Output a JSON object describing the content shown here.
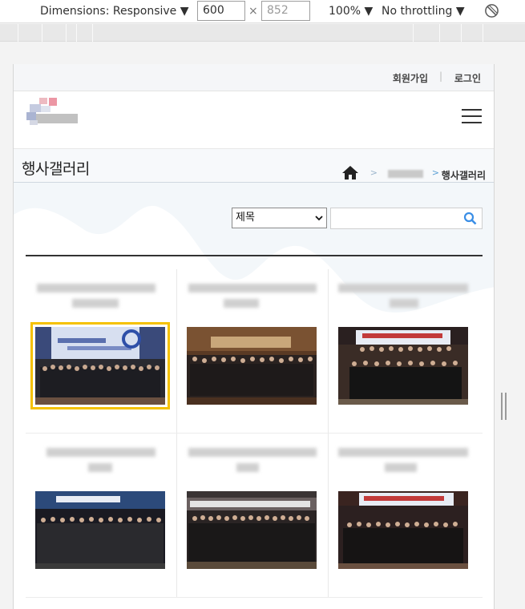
{
  "devtools": {
    "dimensions_label": "Dimensions: Responsive ▼",
    "width": "600",
    "times": "×",
    "height": "852",
    "zoom": "100% ▼",
    "throttling": "No throttling ▼"
  },
  "util": {
    "join": "회원가입",
    "separator": "|",
    "login": "로그인"
  },
  "page": {
    "title": "행사갤러리",
    "breadcrumb_current": "행사갤러리",
    "arrow": ">"
  },
  "search": {
    "field_selected": "제목",
    "query": ""
  },
  "colors": {
    "selected_outline": "#f5c100",
    "accent_blue": "#3a8ee6"
  },
  "gallery": {
    "items": [
      {
        "caption": "",
        "scene": "navy"
      },
      {
        "caption": "",
        "scene": "brown"
      },
      {
        "caption": "",
        "scene": "dark"
      },
      {
        "caption": "",
        "scene": "navy2"
      },
      {
        "caption": "",
        "scene": "brown2"
      },
      {
        "caption": "",
        "scene": "dark2"
      }
    ]
  }
}
